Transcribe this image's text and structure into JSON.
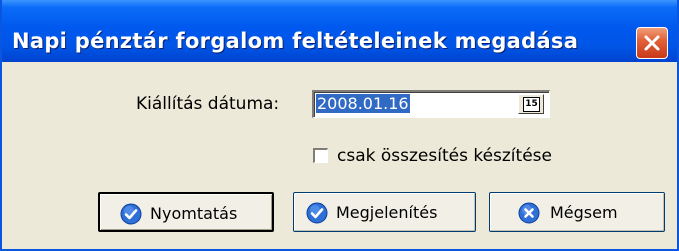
{
  "window": {
    "title": "Napi pénztár forgalom feltételeinek megadása",
    "close_icon": "close-x-icon",
    "accent_color": "#0055e6"
  },
  "form": {
    "date_label": "Kiállítás dátuma:",
    "date_value": "2008.01.16",
    "calendar_button_text": "15",
    "calendar_icon": "calendar-icon",
    "summary_only_label": "csak összesítés készítése",
    "summary_only_checked": false
  },
  "buttons": {
    "print_label": "Nyomtatás",
    "print_icon": "checkmark-icon",
    "display_label": "Megjelenítés",
    "display_icon": "checkmark-icon",
    "cancel_label": "Mégsem",
    "cancel_icon": "x-icon"
  }
}
